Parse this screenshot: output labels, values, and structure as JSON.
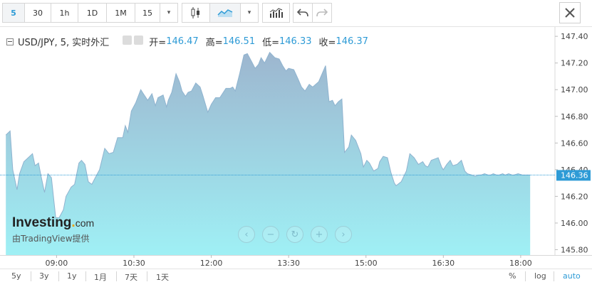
{
  "toolbar": {
    "intervals": [
      "5",
      "30",
      "1h",
      "1D",
      "1M",
      "15"
    ],
    "active_interval": "5",
    "dropdown_arrow": "▾",
    "icons": [
      "candlestick-icon",
      "area-chart-icon",
      "indicators-icon",
      "undo-icon",
      "redo-icon",
      "close-icon"
    ]
  },
  "info": {
    "symbol": "USD/JPY, 5, 实时外汇",
    "open_label": "开=",
    "open": "146.47",
    "high_label": "高=",
    "high": "146.51",
    "low_label": "低=",
    "low": "146.33",
    "close_label": "收=",
    "close": "146.37"
  },
  "logo": {
    "main": "Investing",
    "dot": ".",
    "tld": "com",
    "sub": "由TradingView提供"
  },
  "zoom_controls": [
    "‹",
    "−",
    "↻",
    "+",
    "›"
  ],
  "bottom": {
    "ranges": [
      "5y",
      "3y",
      "1y",
      "1月",
      "7天",
      "1天"
    ],
    "options": [
      "%",
      "log",
      "auto"
    ],
    "active_option": "auto"
  },
  "colors": {
    "accent": "#2e9bd6",
    "area_top": "#9db6cf",
    "area_bottom": "#9ff0f5",
    "line": "#8fb3cf"
  },
  "chart_data": {
    "type": "area",
    "title": "USD/JPY, 5, 实时外汇",
    "xlabel": "",
    "ylabel": "",
    "x_ticks": [
      "09:00",
      "10:30",
      "12:00",
      "13:30",
      "15:00",
      "16:30",
      "18:00"
    ],
    "x_tick_minutes": [
      540,
      630,
      720,
      810,
      900,
      990,
      1080
    ],
    "y_ticks": [
      "145.80",
      "146.00",
      "146.20",
      "146.40",
      "146.60",
      "146.80",
      "147.00",
      "147.20",
      "147.40"
    ],
    "ylim": [
      145.76,
      147.47
    ],
    "xlim_minutes": [
      480,
      1095
    ],
    "last_price_label": "146.36",
    "last_price": 146.36,
    "grid": false,
    "series": [
      {
        "x_minutes": [
          481,
          486,
          489,
          494,
          497,
          502,
          507,
          512,
          515,
          519,
          522,
          526,
          530,
          534,
          539,
          543,
          548,
          551,
          557,
          561,
          566,
          569,
          573,
          577,
          581,
          585,
          590,
          596,
          601,
          606,
          611,
          617,
          620,
          623,
          627,
          632,
          638,
          641,
          646,
          651,
          655,
          658,
          664,
          668,
          670,
          674,
          679,
          683,
          686,
          690,
          693,
          697,
          702,
          707,
          710,
          716,
          720,
          725,
          730,
          737,
          742,
          745,
          748,
          753,
          758,
          762,
          767,
          771,
          775,
          778,
          782,
          788,
          794,
          799,
          803,
          807,
          810,
          816,
          821,
          825,
          829,
          834,
          838,
          845,
          853,
          857,
          861,
          864,
          868,
          872,
          875,
          880,
          883,
          888,
          894,
          897,
          901,
          904,
          909,
          914,
          916,
          920,
          925,
          929,
          933,
          935,
          941,
          947,
          951,
          956,
          961,
          966,
          969,
          972,
          976,
          980,
          984,
          988,
          990,
          994,
          998,
          1001,
          1006,
          1011,
          1015,
          1018,
          1023,
          1027,
          1031,
          1034,
          1038,
          1042,
          1045,
          1048,
          1052,
          1055,
          1059,
          1062,
          1066,
          1070,
          1072,
          1077,
          1082,
          1087,
          1091
        ],
        "values": [
          146.66,
          146.69,
          146.4,
          146.25,
          146.37,
          146.46,
          146.49,
          146.52,
          146.43,
          146.45,
          146.35,
          146.23,
          146.37,
          146.34,
          146.04,
          146.04,
          146.1,
          146.2,
          146.27,
          146.29,
          146.45,
          146.47,
          146.44,
          146.31,
          146.29,
          146.34,
          146.4,
          146.56,
          146.52,
          146.53,
          146.64,
          146.64,
          146.73,
          146.68,
          146.84,
          146.9,
          147.0,
          146.97,
          146.92,
          146.97,
          146.88,
          146.94,
          146.96,
          146.87,
          146.92,
          146.98,
          147.12,
          147.06,
          146.99,
          146.95,
          146.98,
          146.99,
          147.05,
          147.02,
          146.96,
          146.83,
          146.89,
          146.94,
          146.94,
          147.01,
          147.01,
          147.02,
          146.99,
          147.12,
          147.26,
          147.27,
          147.21,
          147.16,
          147.19,
          147.24,
          147.2,
          147.28,
          147.24,
          147.23,
          147.18,
          147.14,
          147.16,
          147.15,
          147.08,
          147.02,
          146.99,
          147.04,
          147.02,
          147.06,
          147.18,
          146.91,
          146.92,
          146.88,
          146.91,
          146.93,
          146.53,
          146.57,
          146.66,
          146.62,
          146.52,
          146.42,
          146.47,
          146.45,
          146.39,
          146.41,
          146.46,
          146.5,
          146.49,
          146.38,
          146.3,
          146.28,
          146.31,
          146.39,
          146.52,
          146.49,
          146.44,
          146.46,
          146.43,
          146.42,
          146.47,
          146.48,
          146.49,
          146.42,
          146.4,
          146.44,
          146.47,
          146.43,
          146.44,
          146.47,
          146.39,
          146.37,
          146.36,
          146.35,
          146.36,
          146.36,
          146.37,
          146.36,
          146.36,
          146.37,
          146.36,
          146.36,
          146.37,
          146.36,
          146.37,
          146.36,
          146.36,
          146.37,
          146.36,
          146.36,
          146.36
        ]
      }
    ]
  }
}
